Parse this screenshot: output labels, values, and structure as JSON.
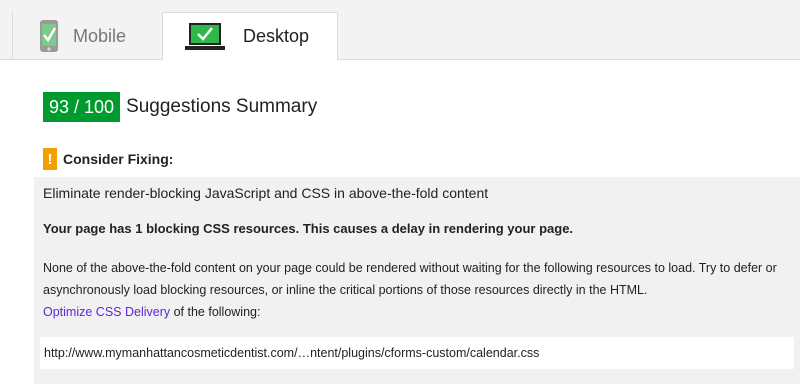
{
  "tabs": {
    "mobile_label": "Mobile",
    "desktop_label": "Desktop"
  },
  "summary": {
    "score": "93 / 100",
    "title": "Suggestions Summary"
  },
  "consider": {
    "icon_glyph": "!",
    "label": "Consider Fixing:"
  },
  "rule": {
    "title": "Eliminate render-blocking JavaScript and CSS in above-the-fold content",
    "bold_text": "Your page has 1 blocking CSS resources. This causes a delay in rendering your page.",
    "description": "None of the above-the-fold content on your page could be rendered without waiting for the following resources to load. Try to defer or asynchronously load blocking resources, or inline the critical portions of those resources directly in the HTML.",
    "link_text": "Optimize CSS Delivery",
    "action_suffix": " of the following:",
    "resource_url": "http://www.mymanhattancosmeticdentist.com/…ntent/plugins/cforms-custom/calendar.css"
  },
  "colors": {
    "score_badge": "#009a2e",
    "warning": "#f4a000",
    "link": "#5a2ad0",
    "icon_green": "#2fb84a"
  },
  "icons": {
    "mobile": "mobile-phone-check-icon",
    "desktop": "desktop-monitor-check-icon",
    "warning": "warning-exclamation-icon"
  }
}
